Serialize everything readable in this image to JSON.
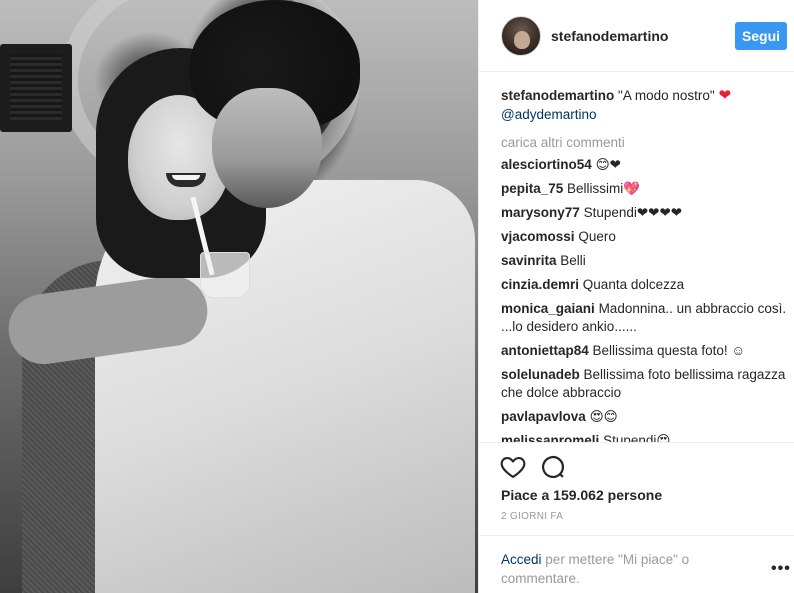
{
  "post": {
    "username": "stefanodemartino",
    "follow_label": "Segui",
    "caption_text": "\"A modo nostro\"",
    "caption_heart": "❤",
    "caption_mention": "@adydemartino"
  },
  "load_more": "carica altri commenti",
  "comments": [
    {
      "user": "alesciortino54",
      "text": "😊❤"
    },
    {
      "user": "pepita_75",
      "text": "Bellissimi💖"
    },
    {
      "user": "marysony77",
      "text": "Stupendi❤❤❤❤"
    },
    {
      "user": "vjacomossi",
      "text": "Quero"
    },
    {
      "user": "savinrita",
      "text": "Belli"
    },
    {
      "user": "cinzia.demri",
      "text": "Quanta dolcezza"
    },
    {
      "user": "monica_gaiani",
      "text": "Madonnina.. un abbraccio così. ...lo desidero ankio......"
    },
    {
      "user": "antoniettap84",
      "text": "Bellissima questa foto! ☺"
    },
    {
      "user": "solelunadeb",
      "text": "Bellissima foto bellissima ragazza che dolce abbraccio"
    },
    {
      "user": "pavlapavlova",
      "text": "😍😊"
    },
    {
      "user": "melissanromeli",
      "text": "Stupendi😍"
    }
  ],
  "likes_text": "Piace a 159.062 persone",
  "time_text": "2 GIORNI FA",
  "login": {
    "link": "Accedi",
    "rest": "per mettere \"Mi piace\" o commentare."
  },
  "icons": {
    "like": "heart-outline-icon",
    "comment": "comment-bubble-icon",
    "more": "more-options-icon"
  },
  "colors": {
    "accent": "#3897f0",
    "link": "#003569",
    "heart": "#ed1c35",
    "muted": "#999999"
  }
}
